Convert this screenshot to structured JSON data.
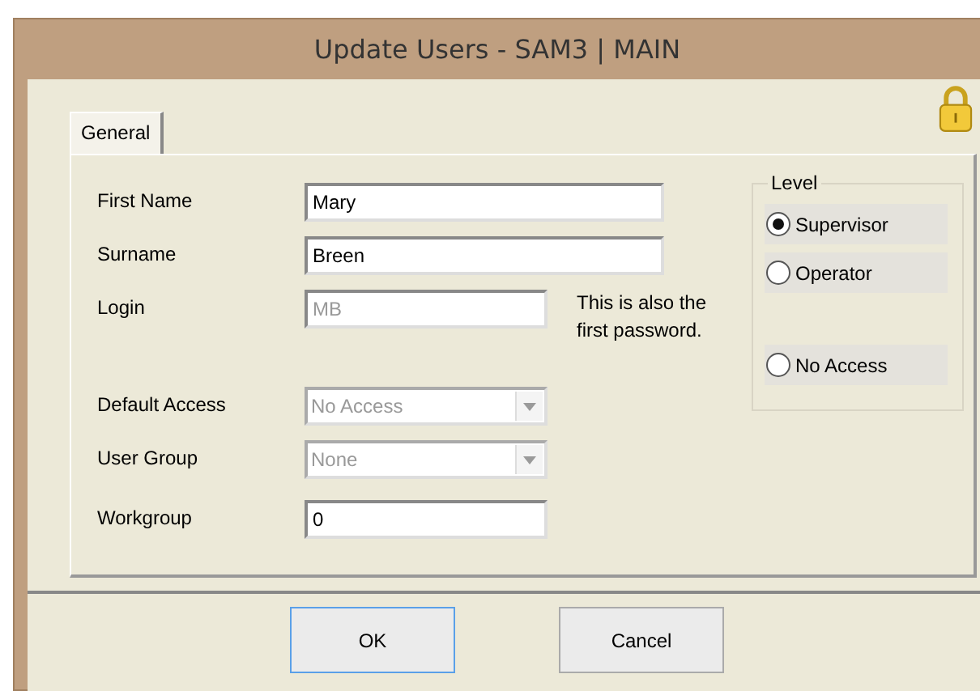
{
  "window": {
    "title": "Update Users - SAM3 | MAIN"
  },
  "tabs": [
    {
      "label": "General",
      "selected": true
    }
  ],
  "fields": [
    {
      "label": "First Name",
      "value": "Mary",
      "kind": "text",
      "disabled": false
    },
    {
      "label": "Surname",
      "value": "Breen",
      "kind": "text",
      "disabled": false
    },
    {
      "label": "Login",
      "value": "MB",
      "kind": "short",
      "disabled": true,
      "note": "This is also the first password."
    },
    {
      "label": "Default Access",
      "value": "No Access",
      "kind": "dropdown",
      "disabled": true
    },
    {
      "label": "User Group",
      "value": "None",
      "kind": "dropdown",
      "disabled": true
    },
    {
      "label": "Workgroup",
      "value": "0",
      "kind": "short",
      "disabled": false
    }
  ],
  "level": {
    "title": "Level",
    "options": [
      {
        "label": "Supervisor",
        "selected": true
      },
      {
        "label": "Operator",
        "selected": false
      },
      {
        "label": "No Access",
        "selected": false
      }
    ]
  },
  "buttons": [
    {
      "label": "OK",
      "focused": true
    },
    {
      "label": "Cancel",
      "focused": false
    }
  ]
}
